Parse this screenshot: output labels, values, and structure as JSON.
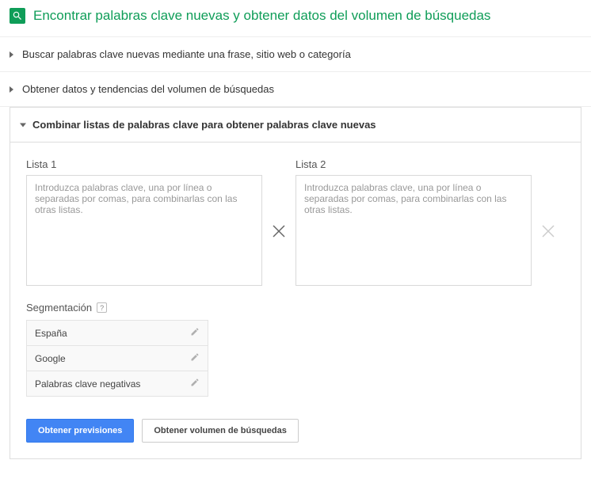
{
  "header": {
    "title": "Encontrar palabras clave nuevas y obtener datos del volumen de búsquedas"
  },
  "accordion": {
    "item1": "Buscar palabras clave nuevas mediante una frase, sitio web o categoría",
    "item2": "Obtener datos y tendencias del volumen de búsquedas",
    "item3": "Combinar listas de palabras clave para obtener palabras clave nuevas"
  },
  "lists": {
    "label1": "Lista 1",
    "label2": "Lista 2",
    "placeholder": "Introduzca palabras clave, una por línea o separadas por comas, para combinarlas con las otras listas."
  },
  "segmentation": {
    "title": "Segmentación",
    "help": "?",
    "rows": {
      "r0": "España",
      "r1": "Google",
      "r2": "Palabras clave negativas"
    }
  },
  "buttons": {
    "primary": "Obtener previsiones",
    "secondary": "Obtener volumen de búsquedas"
  }
}
